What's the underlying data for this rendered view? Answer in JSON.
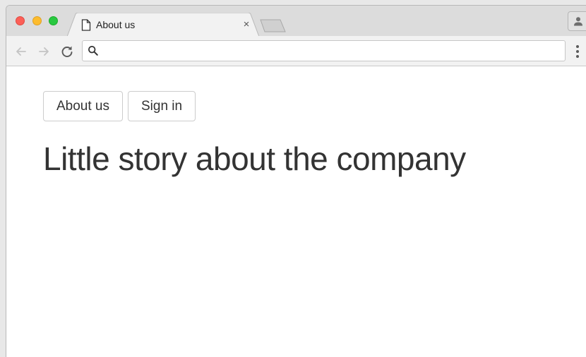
{
  "browser": {
    "tab": {
      "title": "About us",
      "close_glyph": "×",
      "icon": "document-icon"
    },
    "toolbar": {
      "address_value": "",
      "address_placeholder": "",
      "icons": [
        "back-arrow-icon",
        "forward-arrow-icon",
        "reload-icon",
        "search-icon",
        "more-vert-icon",
        "profile-icon"
      ]
    },
    "window_controls": {
      "close_color": "#fc5f57",
      "minimize_color": "#fdbc2e",
      "maximize_color": "#28c840"
    }
  },
  "page": {
    "nav": {
      "about_label": "About us",
      "signin_label": "Sign in"
    },
    "heading": "Little story about the company"
  }
}
